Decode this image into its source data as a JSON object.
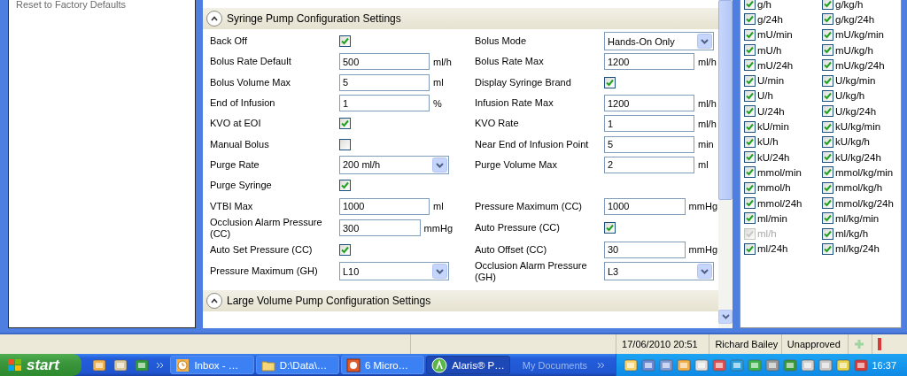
{
  "left_panel": {
    "items": [
      "Reset to Factory Defaults"
    ]
  },
  "sections": [
    {
      "title": "Syringe Pump Configuration Settings",
      "expanded": true,
      "rows": [
        {
          "left": {
            "kind": "checkbox",
            "label": "Back Off",
            "checked": true
          },
          "right": {
            "kind": "dropdown",
            "label": "Bolus Mode",
            "value": "Hands-On Only"
          }
        },
        {
          "left": {
            "kind": "text",
            "label": "Bolus Rate Default",
            "value": "500",
            "unit": "ml/h"
          },
          "right": {
            "kind": "text",
            "label": "Bolus Rate Max",
            "value": "1200",
            "unit": "ml/h"
          }
        },
        {
          "left": {
            "kind": "text",
            "label": "Bolus Volume Max",
            "value": "5",
            "unit": "ml"
          },
          "right": {
            "kind": "checkbox",
            "label": "Display Syringe Brand",
            "checked": true
          }
        },
        {
          "left": {
            "kind": "text",
            "label": "End of Infusion",
            "value": "1",
            "unit": "%"
          },
          "right": {
            "kind": "text",
            "label": "Infusion Rate Max",
            "value": "1200",
            "unit": "ml/h"
          }
        },
        {
          "left": {
            "kind": "checkbox",
            "label": "KVO at EOI",
            "checked": true
          },
          "right": {
            "kind": "text",
            "label": "KVO Rate",
            "value": "1",
            "unit": "ml/h"
          }
        },
        {
          "left": {
            "kind": "checkbox",
            "label": "Manual Bolus",
            "checked": false
          },
          "right": {
            "kind": "text",
            "label": "Near End of Infusion Point",
            "value": "5",
            "unit": "min"
          }
        },
        {
          "left": {
            "kind": "dropdown",
            "label": "Purge Rate",
            "value": "200 ml/h"
          },
          "right": {
            "kind": "text",
            "label": "Purge Volume Max",
            "value": "2",
            "unit": "ml"
          }
        },
        {
          "left": {
            "kind": "checkbox",
            "label": "Purge Syringe",
            "checked": true
          },
          "right": {
            "kind": "empty"
          }
        },
        {
          "left": {
            "kind": "text",
            "label": "VTBI Max",
            "value": "1000",
            "unit": "ml"
          },
          "right": {
            "kind": "text",
            "label": "Pressure Maximum (CC)",
            "value": "1000",
            "unit": "mmHg"
          }
        },
        {
          "left": {
            "kind": "text",
            "label": "Occlusion Alarm Pressure (CC)",
            "value": "300",
            "unit": "mmHg"
          },
          "right": {
            "kind": "checkbox",
            "label": "Auto Pressure (CC)",
            "checked": true
          }
        },
        {
          "left": {
            "kind": "checkbox",
            "label": "Auto Set Pressure (CC)",
            "checked": true
          },
          "right": {
            "kind": "text",
            "label": "Auto Offset (CC)",
            "value": "30",
            "unit": "mmHg"
          }
        },
        {
          "left": {
            "kind": "dropdown",
            "label": "Pressure Maximum (GH)",
            "value": "L10"
          },
          "right": {
            "kind": "dropdown",
            "label": "Occlusion Alarm Pressure (GH)",
            "value": "L3"
          }
        }
      ]
    },
    {
      "title": "Large Volume Pump Configuration Settings",
      "expanded": true
    }
  ],
  "units": [
    {
      "label": "g/h",
      "checked": true,
      "disabled": false
    },
    {
      "label": "g/kg/h",
      "checked": true,
      "disabled": false
    },
    {
      "label": "g/24h",
      "checked": true,
      "disabled": false
    },
    {
      "label": "g/kg/24h",
      "checked": true,
      "disabled": false
    },
    {
      "label": "mU/min",
      "checked": true,
      "disabled": false
    },
    {
      "label": "mU/kg/min",
      "checked": true,
      "disabled": false
    },
    {
      "label": "mU/h",
      "checked": true,
      "disabled": false
    },
    {
      "label": "mU/kg/h",
      "checked": true,
      "disabled": false
    },
    {
      "label": "mU/24h",
      "checked": true,
      "disabled": false
    },
    {
      "label": "mU/kg/24h",
      "checked": true,
      "disabled": false
    },
    {
      "label": "U/min",
      "checked": true,
      "disabled": false
    },
    {
      "label": "U/kg/min",
      "checked": true,
      "disabled": false
    },
    {
      "label": "U/h",
      "checked": true,
      "disabled": false
    },
    {
      "label": "U/kg/h",
      "checked": true,
      "disabled": false
    },
    {
      "label": "U/24h",
      "checked": true,
      "disabled": false
    },
    {
      "label": "U/kg/24h",
      "checked": true,
      "disabled": false
    },
    {
      "label": "kU/min",
      "checked": true,
      "disabled": false
    },
    {
      "label": "kU/kg/min",
      "checked": true,
      "disabled": false
    },
    {
      "label": "kU/h",
      "checked": true,
      "disabled": false
    },
    {
      "label": "kU/kg/h",
      "checked": true,
      "disabled": false
    },
    {
      "label": "kU/24h",
      "checked": true,
      "disabled": false
    },
    {
      "label": "kU/kg/24h",
      "checked": true,
      "disabled": false
    },
    {
      "label": "mmol/min",
      "checked": true,
      "disabled": false
    },
    {
      "label": "mmol/kg/min",
      "checked": true,
      "disabled": false
    },
    {
      "label": "mmol/h",
      "checked": true,
      "disabled": false
    },
    {
      "label": "mmol/kg/h",
      "checked": true,
      "disabled": false
    },
    {
      "label": "mmol/24h",
      "checked": true,
      "disabled": false
    },
    {
      "label": "mmol/kg/24h",
      "checked": true,
      "disabled": false
    },
    {
      "label": "ml/min",
      "checked": true,
      "disabled": false
    },
    {
      "label": "ml/kg/min",
      "checked": true,
      "disabled": false
    },
    {
      "label": "ml/h",
      "checked": true,
      "disabled": true
    },
    {
      "label": "ml/kg/h",
      "checked": true,
      "disabled": false
    },
    {
      "label": "ml/24h",
      "checked": true,
      "disabled": false
    },
    {
      "label": "ml/kg/24h",
      "checked": true,
      "disabled": false
    }
  ],
  "status_bar": [
    "17/06/2010 20:51",
    "Richard Bailey",
    "Unapproved"
  ],
  "taskbar": {
    "start": "start",
    "buttons": [
      {
        "label": "Inbox - …",
        "selected": false
      },
      {
        "label": "D:\\Data\\…",
        "selected": false
      },
      {
        "label": "6 Micro…",
        "selected": false
      },
      {
        "label": "Alaris® P…",
        "selected": true
      }
    ],
    "toolbar_label": "My Documents",
    "clock": "16:37"
  }
}
